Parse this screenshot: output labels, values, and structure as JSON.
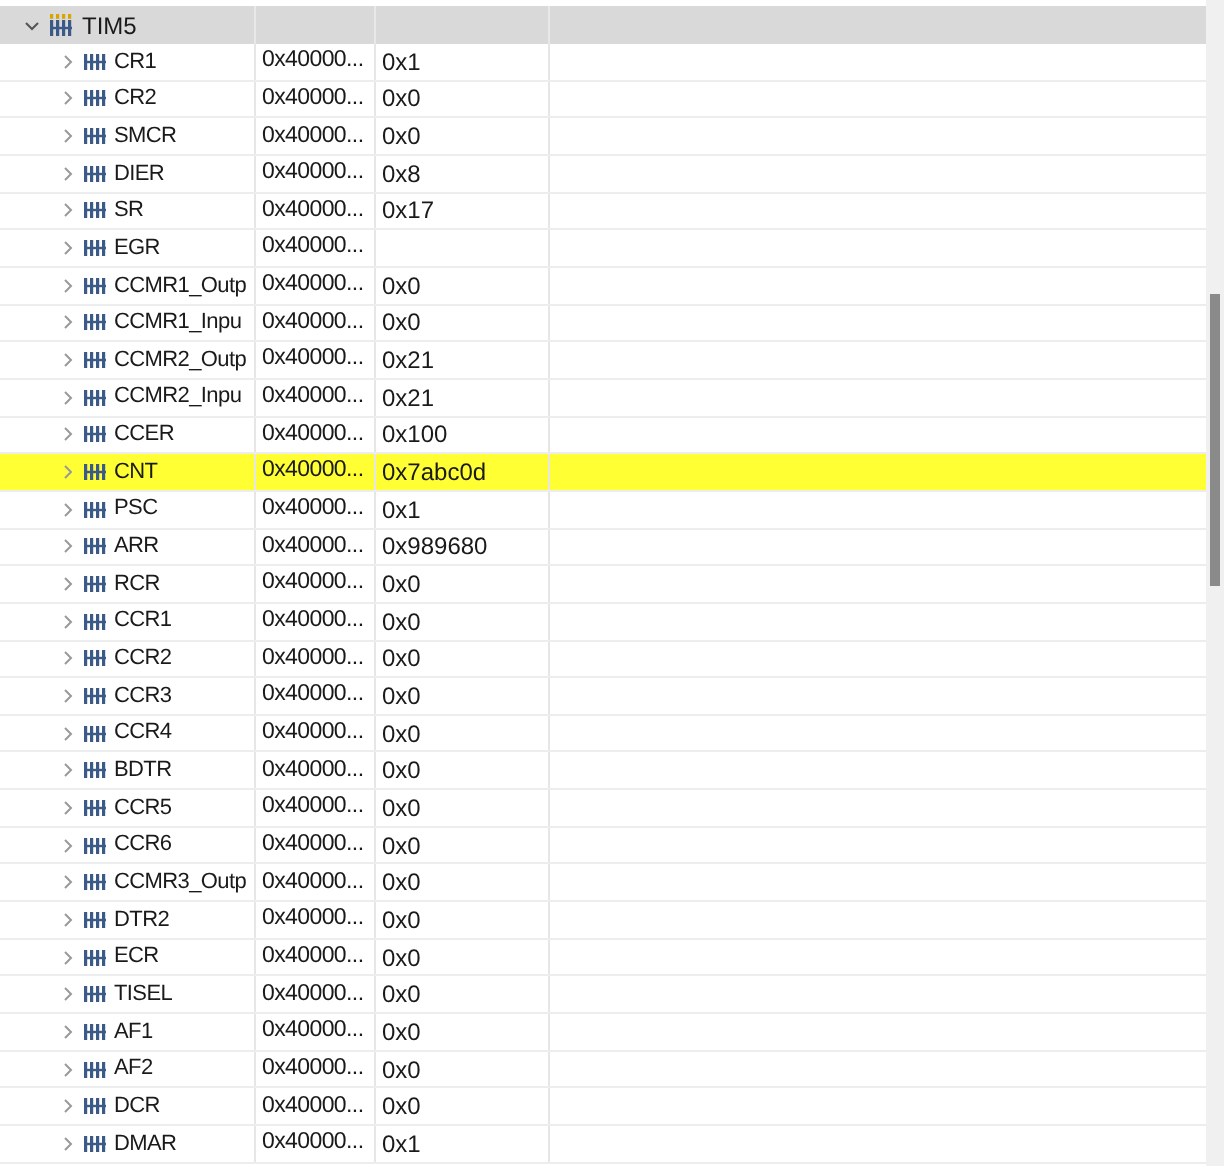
{
  "peripheral": {
    "name": "TIM5",
    "expanded": true,
    "registers": [
      {
        "name": "CR1",
        "address": "0x40000...",
        "value": "0x1",
        "highlighted": false,
        "expanded": false
      },
      {
        "name": "CR2",
        "address": "0x40000...",
        "value": "0x0",
        "highlighted": false,
        "expanded": false
      },
      {
        "name": "SMCR",
        "address": "0x40000...",
        "value": "0x0",
        "highlighted": false,
        "expanded": false
      },
      {
        "name": "DIER",
        "address": "0x40000...",
        "value": "0x8",
        "highlighted": false,
        "expanded": false
      },
      {
        "name": "SR",
        "address": "0x40000...",
        "value": "0x17",
        "highlighted": false,
        "expanded": false
      },
      {
        "name": "EGR",
        "address": "0x40000...",
        "highlighted": false,
        "expanded": false
      },
      {
        "name": "CCMR1_Outp",
        "address": "0x40000...",
        "value": "0x0",
        "highlighted": false,
        "expanded": false
      },
      {
        "name": "CCMR1_Inpu",
        "address": "0x40000...",
        "value": "0x0",
        "highlighted": false,
        "expanded": false
      },
      {
        "name": "CCMR2_Outp",
        "address": "0x40000...",
        "value": "0x21",
        "highlighted": false,
        "expanded": false
      },
      {
        "name": "CCMR2_Inpu",
        "address": "0x40000...",
        "value": "0x21",
        "highlighted": false,
        "expanded": false
      },
      {
        "name": "CCER",
        "address": "0x40000...",
        "value": "0x100",
        "highlighted": false,
        "expanded": false
      },
      {
        "name": "CNT",
        "address": "0x40000...",
        "value": "0x7abc0d",
        "highlighted": true,
        "expanded": false
      },
      {
        "name": "PSC",
        "address": "0x40000...",
        "value": "0x1",
        "highlighted": false,
        "expanded": false
      },
      {
        "name": "ARR",
        "address": "0x40000...",
        "value": "0x989680",
        "highlighted": false,
        "expanded": false
      },
      {
        "name": "RCR",
        "address": "0x40000...",
        "value": "0x0",
        "highlighted": false,
        "expanded": false
      },
      {
        "name": "CCR1",
        "address": "0x40000...",
        "value": "0x0",
        "highlighted": false,
        "expanded": false
      },
      {
        "name": "CCR2",
        "address": "0x40000...",
        "value": "0x0",
        "highlighted": false,
        "expanded": false
      },
      {
        "name": "CCR3",
        "address": "0x40000...",
        "value": "0x0",
        "highlighted": false,
        "expanded": false
      },
      {
        "name": "CCR4",
        "address": "0x40000...",
        "value": "0x0",
        "highlighted": false,
        "expanded": false
      },
      {
        "name": "BDTR",
        "address": "0x40000...",
        "value": "0x0",
        "highlighted": false,
        "expanded": false
      },
      {
        "name": "CCR5",
        "address": "0x40000...",
        "value": "0x0",
        "highlighted": false,
        "expanded": false
      },
      {
        "name": "CCR6",
        "address": "0x40000...",
        "value": "0x0",
        "highlighted": false,
        "expanded": false
      },
      {
        "name": "CCMR3_Outp",
        "address": "0x40000...",
        "value": "0x0",
        "highlighted": false,
        "expanded": false
      },
      {
        "name": "DTR2",
        "address": "0x40000...",
        "value": "0x0",
        "highlighted": false,
        "expanded": false
      },
      {
        "name": "ECR",
        "address": "0x40000...",
        "value": "0x0",
        "highlighted": false,
        "expanded": false
      },
      {
        "name": "TISEL",
        "address": "0x40000...",
        "value": "0x0",
        "highlighted": false,
        "expanded": false
      },
      {
        "name": "AF1",
        "address": "0x40000...",
        "value": "0x0",
        "highlighted": false,
        "expanded": false
      },
      {
        "name": "AF2",
        "address": "0x40000...",
        "value": "0x0",
        "highlighted": false,
        "expanded": false
      },
      {
        "name": "DCR",
        "address": "0x40000...",
        "value": "0x0",
        "highlighted": false,
        "expanded": false
      },
      {
        "name": "DMAR",
        "address": "0x40000...",
        "value": "0x1",
        "highlighted": false,
        "expanded": false
      }
    ]
  }
}
